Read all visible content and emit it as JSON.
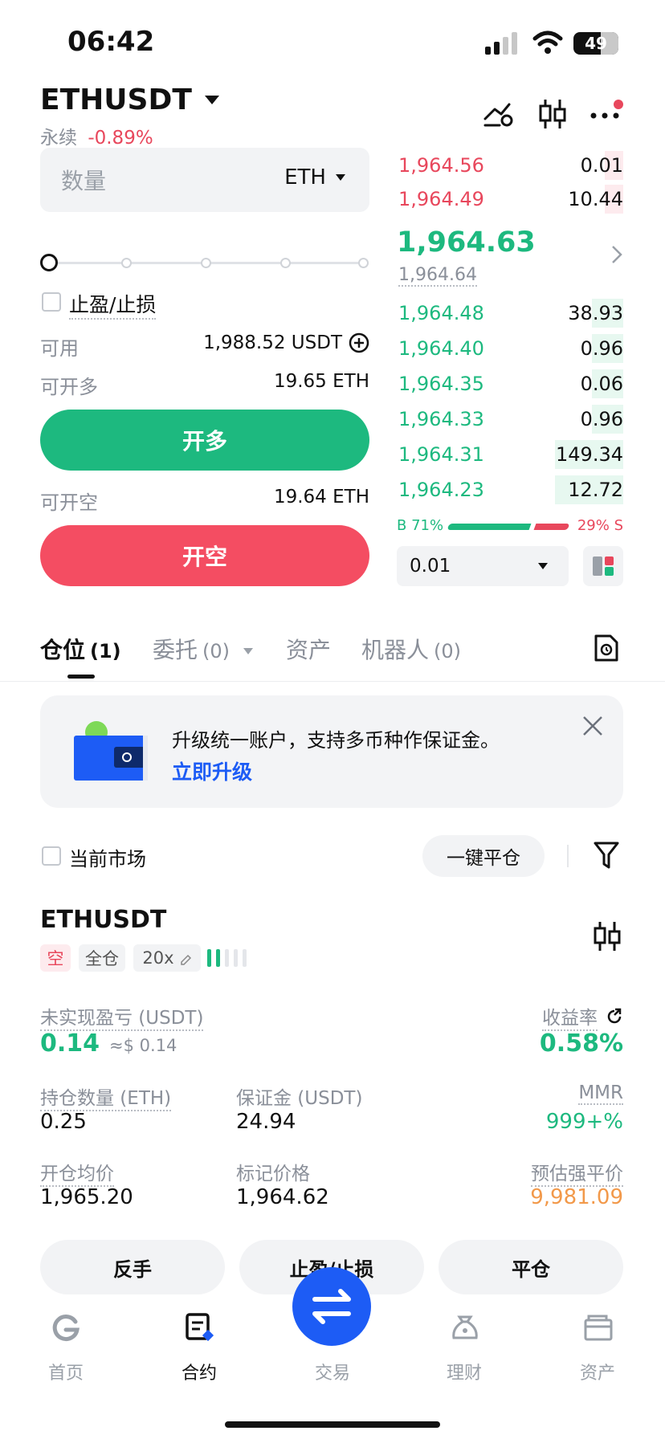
{
  "status_bar": {
    "time": "06:42",
    "battery": "49"
  },
  "header": {
    "symbol": "ETHUSDT",
    "type": "永续",
    "change": "-0.89%"
  },
  "order_form": {
    "qty_placeholder": "数量",
    "qty_unit": "ETH",
    "leverage_slider_value": 0,
    "tpsl_label": "止盈/止损",
    "available_label": "可用",
    "available_value": "1,988.52 USDT",
    "can_long_label": "可开多",
    "can_long_value": "19.65 ETH",
    "long_button": "开多",
    "can_short_label": "可开空",
    "can_short_value": "19.64 ETH",
    "short_button": "开空"
  },
  "orderbook": {
    "asks": [
      {
        "price": "1,964.56",
        "qty": "0.01",
        "depth": 0.08
      },
      {
        "price": "1,964.49",
        "qty": "10.44",
        "depth": 0.08
      }
    ],
    "last_price": "1,964.63",
    "mark_price": "1,964.64",
    "bids": [
      {
        "price": "1,964.48",
        "qty": "38.93",
        "depth": 0.14
      },
      {
        "price": "1,964.40",
        "qty": "0.96",
        "depth": 0.14
      },
      {
        "price": "1,964.35",
        "qty": "0.06",
        "depth": 0.14
      },
      {
        "price": "1,964.33",
        "qty": "0.96",
        "depth": 0.14
      },
      {
        "price": "1,964.31",
        "qty": "149.34",
        "depth": 0.3
      },
      {
        "price": "1,964.23",
        "qty": "12.72",
        "depth": 0.3
      }
    ],
    "buy_ratio_label": "B 71%",
    "sell_ratio_label": "29% S",
    "buy_ratio": 0.71,
    "precision": "0.01"
  },
  "tabs": [
    {
      "label": "仓位",
      "count": "(1)"
    },
    {
      "label": "委托",
      "count": "(0)"
    },
    {
      "label": "资产",
      "count": ""
    },
    {
      "label": "机器人",
      "count": "(0)"
    }
  ],
  "banner": {
    "text": "升级统一账户，支持多币种作保证金。",
    "link": "立即升级"
  },
  "filter": {
    "current_market": "当前市场",
    "close_all": "一键平仓"
  },
  "position": {
    "symbol": "ETHUSDT",
    "side": "空",
    "margin_mode": "全仓",
    "leverage": "20x",
    "upnl_label": "未实现盈亏 (USDT)",
    "upnl_value": "0.14",
    "upnl_usd": "≈$ 0.14",
    "roe_label": "收益率",
    "roe_value": "0.58%",
    "size_label": "持仓数量 (ETH)",
    "size_value": "0.25",
    "margin_label": "保证金 (USDT)",
    "margin_value": "24.94",
    "mmr_label": "MMR",
    "mmr_value": "999+%",
    "entry_label": "开仓均价",
    "entry_value": "1,965.20",
    "mark_label": "标记价格",
    "mark_value": "1,964.62",
    "liq_label": "预估强平价",
    "liq_value": "9,981.09",
    "btn_reverse": "反手",
    "btn_tpsl": "止盈/止损",
    "btn_close": "平仓"
  },
  "bottom_nav": [
    {
      "label": "首页",
      "icon": "home-icon"
    },
    {
      "label": "合约",
      "icon": "futures-icon"
    },
    {
      "label": "交易",
      "icon": "swap-icon"
    },
    {
      "label": "理财",
      "icon": "earn-icon"
    },
    {
      "label": "资产",
      "icon": "wallet-icon"
    }
  ],
  "colors": {
    "green": "#1DB97F",
    "red": "#E8475C",
    "blue": "#1D5CF5",
    "orange": "#F2994A"
  }
}
